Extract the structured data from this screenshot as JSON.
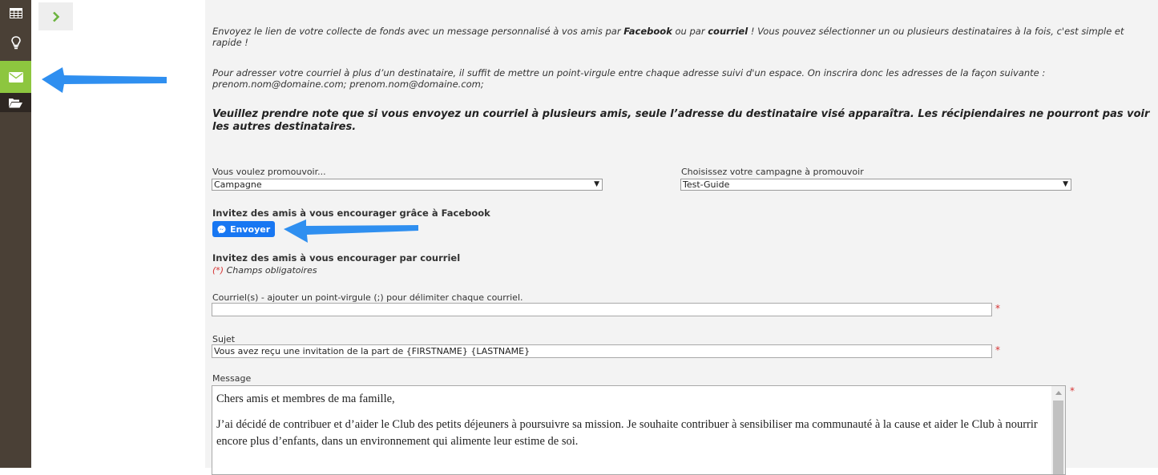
{
  "sidebar": {
    "items": [
      {
        "icon": "table-icon"
      },
      {
        "icon": "lightbulb-icon"
      },
      {
        "icon": "envelope-icon",
        "active": true
      },
      {
        "icon": "folder-open-icon"
      }
    ],
    "expander_icon": "chevron-right-icon",
    "accent_color": "#8dc63f"
  },
  "intro": {
    "p1_a": "Envoyez le lien de votre collecte de fonds avec un message personnalisé à vos amis par ",
    "p1_facebook": "Facebook",
    "p1_b": " ou par ",
    "p1_courriel": "courriel",
    "p1_c": " ! Vous pouvez sélectionner un ou plusieurs destinataires à la fois, c'est simple et rapide !",
    "p2": "Pour adresser votre courriel à plus d’un destinataire, il suffit de mettre un point-virgule entre chaque adresse suivi d'un espace. On inscrira donc les adresses de la façon suivante : prenom.nom@domaine.com; prenom.nom@domaine.com;",
    "notice": "Veuillez prendre note que si vous envoyez un courriel à plusieurs amis, seule l’adresse du destinataire visé apparaîtra. Les récipiendaires ne pourront pas voir les autres destinataires."
  },
  "promote": {
    "label": "Vous voulez promouvoir...",
    "value": "Campagne"
  },
  "campaign": {
    "label": "Choisissez votre campagne à promouvoir",
    "value": "Test-Guide"
  },
  "facebook": {
    "title": "Invitez des amis à vous encourager grâce à Facebook",
    "button_label": "Envoyer",
    "button_icon": "messenger-icon",
    "color": "#1877f2"
  },
  "email_section": {
    "title": "Invitez des amis à vous encourager par courriel",
    "required_star": "(*)",
    "required_text": " Champs obligatoires",
    "emails_label": "Courriel(s) - ajouter un point-virgule (;) pour délimiter chaque courriel.",
    "emails_value": "",
    "subject_label": "Sujet",
    "subject_value": "Vous avez reçu une invitation de la part de {FIRSTNAME} {LASTNAME}",
    "message_label": "Message",
    "message_p1": "Chers amis et membres de ma famille,",
    "message_p2": "J’ai décidé de contribuer et d’aider le Club des petits déjeuners à poursuivre sa mission. Je souhaite contribuer à sensibiliser ma communauté à la cause et aider le Club à nourrir encore plus d’enfants, dans un environnement qui alimente leur estime de soi.",
    "star": "*"
  },
  "annotation_color": "#2f8ff0"
}
